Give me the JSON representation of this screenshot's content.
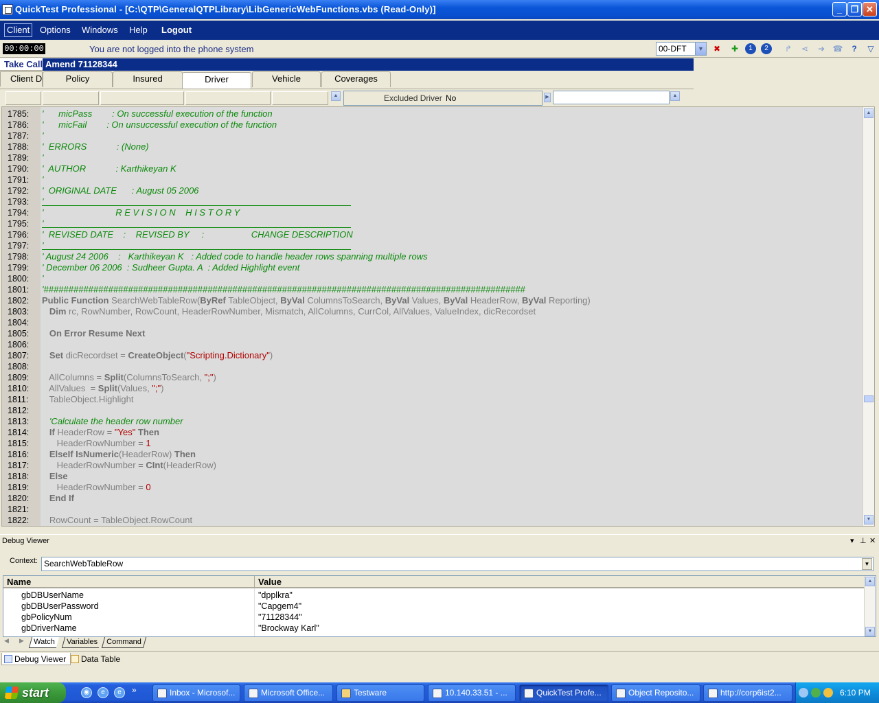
{
  "window": {
    "title": "QuickTest Professional - [C:\\QTP\\GeneralQTPLibrary\\LibGenericWebFunctions.vbs  (Read-Only)]"
  },
  "menu": {
    "items": [
      "Client",
      "Options",
      "Windows",
      "Help",
      "Logout"
    ]
  },
  "status": {
    "timer": "00:00:00",
    "message": "You are not logged into the phone system",
    "station": "00-DFT"
  },
  "app": {
    "take_call_label": "Take Call",
    "amend_label": "Amend 71128344",
    "client_tab": "Client Details",
    "policy_tabs": [
      "Policy",
      "Insured",
      "Driver",
      "Vehicle",
      "Coverages"
    ],
    "active_policy_tab": "Driver",
    "excluded_driver_label": "Excluded Driver",
    "excluded_driver_value": "No"
  },
  "editor": {
    "lines": [
      {
        "n": "1785:",
        "text": "'      micPass        : On successful execution of the function",
        "cls": "cm"
      },
      {
        "n": "1786:",
        "text": "'      micFail        : On unsuccessful execution of the function",
        "cls": "cm"
      },
      {
        "n": "1787:",
        "text": "'",
        "cls": "cm"
      },
      {
        "n": "1788:",
        "text": "'  ERRORS            : (None)",
        "cls": "cm"
      },
      {
        "n": "1789:",
        "text": "'",
        "cls": "cm"
      },
      {
        "n": "1790:",
        "text": "'  AUTHOR            : Karthikeyan K",
        "cls": "cm"
      },
      {
        "n": "1791:",
        "text": "'",
        "cls": "cm"
      },
      {
        "n": "1792:",
        "text": "'  ORIGINAL DATE      : August 05 2006",
        "cls": "cm"
      },
      {
        "n": "1793:",
        "text": "'",
        "cls": "cm"
      },
      {
        "n": "1794:",
        "text": "'                             R E V I S I O N    H I S T O R Y",
        "cls": "cm"
      },
      {
        "n": "1795:",
        "text": "'",
        "cls": "cm"
      },
      {
        "n": "1796:",
        "text": "'  REVISED DATE    :    REVISED BY     :                   CHANGE DESCRIPTION",
        "cls": "cm"
      },
      {
        "n": "1797:",
        "text": "'",
        "cls": "cm"
      },
      {
        "n": "1798:",
        "text": "' August 24 2006    :   Karthikeyan K   : Added code to handle header rows spanning multiple rows",
        "cls": "cm"
      },
      {
        "n": "1799:",
        "text": "' December 06 2006  : Sudheer Gupta. A  : Added Highlight event",
        "cls": "cm"
      },
      {
        "n": "1800:",
        "text": "'",
        "cls": "cm"
      },
      {
        "n": "1801:",
        "text": "'#################################################################################################",
        "cls": "cm"
      },
      {
        "n": "1802:",
        "text": "",
        "cls": "mix"
      },
      {
        "n": "1803:",
        "text": "",
        "cls": "mix"
      },
      {
        "n": "1804:",
        "text": "",
        "cls": "plain"
      },
      {
        "n": "1805:",
        "text": "",
        "cls": "mix"
      },
      {
        "n": "1806:",
        "text": "",
        "cls": "plain"
      },
      {
        "n": "1807:",
        "text": "",
        "cls": "mix"
      },
      {
        "n": "1808:",
        "text": "",
        "cls": "plain"
      },
      {
        "n": "1809:",
        "text": "",
        "cls": "mix"
      },
      {
        "n": "1810:",
        "text": "",
        "cls": "mix"
      },
      {
        "n": "1811:",
        "text": "   TableObject.Highlight",
        "cls": "plain"
      },
      {
        "n": "1812:",
        "text": "",
        "cls": "plain"
      },
      {
        "n": "1813:",
        "text": "   'Calculate the header row number",
        "cls": "cm"
      },
      {
        "n": "1814:",
        "text": "",
        "cls": "mix"
      },
      {
        "n": "1815:",
        "text": "",
        "cls": "mix"
      },
      {
        "n": "1816:",
        "text": "",
        "cls": "mix"
      },
      {
        "n": "1817:",
        "text": "",
        "cls": "mix"
      },
      {
        "n": "1818:",
        "text": "",
        "cls": "mix"
      },
      {
        "n": "1819:",
        "text": "",
        "cls": "mix"
      },
      {
        "n": "1820:",
        "text": "",
        "cls": "mix"
      },
      {
        "n": "1821:",
        "text": "",
        "cls": "plain"
      },
      {
        "n": "1822:",
        "text": "   RowCount = TableObject.RowCount",
        "cls": "plain"
      }
    ],
    "rich": {
      "1802": [
        [
          "kw",
          "Public Function "
        ],
        [
          "p",
          "SearchWebTableRow("
        ],
        [
          "kw",
          "ByRef "
        ],
        [
          "p",
          "TableObject, "
        ],
        [
          "kw",
          "ByVal "
        ],
        [
          "p",
          "ColumnsToSearch, "
        ],
        [
          "kw",
          "ByVal "
        ],
        [
          "p",
          "Values, "
        ],
        [
          "kw",
          "ByVal "
        ],
        [
          "p",
          "HeaderRow, "
        ],
        [
          "kw",
          "ByVal "
        ],
        [
          "p",
          "Reporting)"
        ]
      ],
      "1803": [
        [
          "p",
          "   "
        ],
        [
          "kw",
          "Dim "
        ],
        [
          "p",
          "rc, RowNumber, RowCount, HeaderRowNumber, Mismatch, AllColumns, CurrCol, AllValues, ValueIndex, dicRecordset"
        ]
      ],
      "1805": [
        [
          "p",
          "   "
        ],
        [
          "kw",
          "On Error Resume Next"
        ]
      ],
      "1807": [
        [
          "p",
          "   "
        ],
        [
          "kw",
          "Set "
        ],
        [
          "p",
          "dicRecordset = "
        ],
        [
          "kw",
          "CreateObject"
        ],
        [
          "p",
          "("
        ],
        [
          "st",
          "\"Scripting.Dictionary\""
        ],
        [
          "p",
          ")"
        ]
      ],
      "1809": [
        [
          "p",
          "   AllColumns = "
        ],
        [
          "kw",
          "Split"
        ],
        [
          "p",
          "(ColumnsToSearch, "
        ],
        [
          "st",
          "\";\""
        ],
        [
          "p",
          ")"
        ]
      ],
      "1810": [
        [
          "p",
          "   AllValues  = "
        ],
        [
          "kw",
          "Split"
        ],
        [
          "p",
          "(Values, "
        ],
        [
          "st",
          "\";\""
        ],
        [
          "p",
          ")"
        ]
      ],
      "1814": [
        [
          "p",
          "   "
        ],
        [
          "kw",
          "If "
        ],
        [
          "p",
          "HeaderRow = "
        ],
        [
          "st",
          "\"Yes\""
        ],
        [
          "kw",
          " Then"
        ]
      ],
      "1815": [
        [
          "p",
          "      HeaderRowNumber = "
        ],
        [
          "st",
          "1"
        ]
      ],
      "1816": [
        [
          "p",
          "   "
        ],
        [
          "kw",
          "ElseIf IsNumeric"
        ],
        [
          "p",
          "(HeaderRow) "
        ],
        [
          "kw",
          "Then"
        ]
      ],
      "1817": [
        [
          "p",
          "      HeaderRowNumber = "
        ],
        [
          "kw",
          "CInt"
        ],
        [
          "p",
          "(HeaderRow)"
        ]
      ],
      "1818": [
        [
          "p",
          "   "
        ],
        [
          "kw",
          "Else"
        ]
      ],
      "1819": [
        [
          "p",
          "      HeaderRowNumber = "
        ],
        [
          "st",
          "0"
        ]
      ],
      "1820": [
        [
          "p",
          "   "
        ],
        [
          "kw",
          "End If"
        ]
      ]
    }
  },
  "debug": {
    "title": "Debug Viewer",
    "context_label": "Context:",
    "context_value": "SearchWebTableRow",
    "col_name": "Name",
    "col_value": "Value",
    "rows": [
      {
        "name": "gbDBUserName",
        "value": "\"dpplkra\""
      },
      {
        "name": "gbDBUserPassword",
        "value": "\"Capgem4\""
      },
      {
        "name": "gbPolicyNum",
        "value": "\"71128344\""
      },
      {
        "name": "gbDriverName",
        "value": "\"Brockway Karl\""
      }
    ],
    "tabs": [
      "Watch",
      "Variables",
      "Command"
    ],
    "pane_tabs": [
      "Debug Viewer",
      "Data Table"
    ]
  },
  "taskbar": {
    "start": "start",
    "tasks": [
      "Inbox - Microsof...",
      "Microsoft Office...",
      "Testware",
      "10.140.33.51 - ...",
      "QuickTest Profe...",
      "Object Reposito...",
      "http://corp6ist2..."
    ],
    "active_task": "QuickTest Profe...",
    "clock": "6:10 PM"
  }
}
